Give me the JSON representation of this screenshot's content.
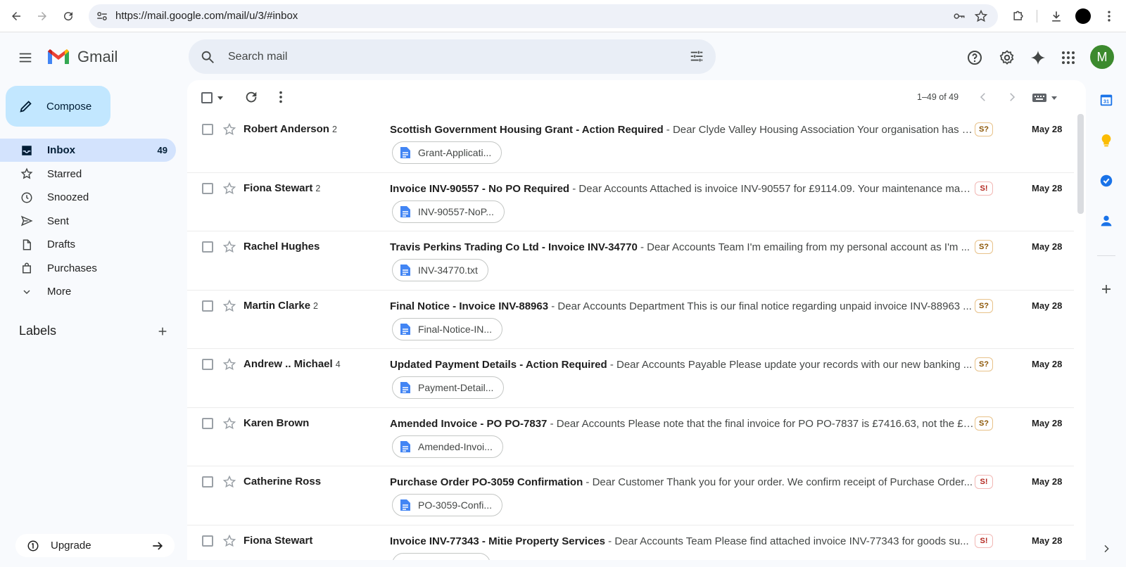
{
  "browser": {
    "url": "https://mail.google.com/mail/u/3/#inbox"
  },
  "header": {
    "app_name": "Gmail",
    "search_placeholder": "Search mail",
    "avatar_letter": "M"
  },
  "sidebar": {
    "compose_label": "Compose",
    "items": [
      {
        "label": "Inbox",
        "count": "49",
        "icon": "inbox-icon",
        "active": true
      },
      {
        "label": "Starred",
        "count": "",
        "icon": "star-icon"
      },
      {
        "label": "Snoozed",
        "count": "",
        "icon": "clock-icon"
      },
      {
        "label": "Sent",
        "count": "",
        "icon": "send-icon"
      },
      {
        "label": "Drafts",
        "count": "",
        "icon": "draft-icon"
      },
      {
        "label": "Purchases",
        "count": "",
        "icon": "shopping-bag-icon"
      },
      {
        "label": "More",
        "count": "",
        "icon": "chevron-down-icon"
      }
    ],
    "labels_heading": "Labels",
    "upgrade_label": "Upgrade"
  },
  "toolbar": {
    "count_text": "1–49 of 49"
  },
  "emails": [
    {
      "sender": "Robert Anderson",
      "thread_count": "2",
      "subject": "Scottish Government Housing Grant - Action Required",
      "snippet": " - Dear Clyde Valley Housing Association Your organisation has b...",
      "badge": "S?",
      "badge_color": "#8a5300",
      "date": "May 28",
      "attachment": "Grant-Applicati..."
    },
    {
      "sender": "Fiona Stewart",
      "thread_count": "2",
      "subject": "Invoice INV-90557 - No PO Required",
      "snippet": " - Dear Accounts Attached is invoice INV-90557 for £9114.09. Your maintenance man...",
      "badge": "S!",
      "badge_color": "#b3261e",
      "date": "May 28",
      "attachment": "INV-90557-NoP..."
    },
    {
      "sender": "Rachel Hughes",
      "thread_count": "",
      "subject": "Travis Perkins Trading Co Ltd - Invoice INV-34770",
      "snippet": " - Dear Accounts Team I'm emailing from my personal account as I'm ...",
      "badge": "S?",
      "badge_color": "#8a5300",
      "date": "May 28",
      "attachment": "INV-34770.txt"
    },
    {
      "sender": "Martin Clarke",
      "thread_count": "2",
      "subject": "Final Notice - Invoice INV-88963",
      "snippet": " - Dear Accounts Department This is our final notice regarding unpaid invoice INV-88963 ...",
      "badge": "S?",
      "badge_color": "#8a5300",
      "date": "May 28",
      "attachment": "Final-Notice-IN..."
    },
    {
      "sender": "Andrew .. Michael",
      "thread_count": "4",
      "subject": "Updated Payment Details - Action Required",
      "snippet": " - Dear Accounts Payable Please update your records with our new banking ...",
      "badge": "S?",
      "badge_color": "#8a5300",
      "date": "May 28",
      "attachment": "Payment-Detail..."
    },
    {
      "sender": "Karen Brown",
      "thread_count": "",
      "subject": "Amended Invoice - PO PO-7837",
      "snippet": " - Dear Accounts Please note that the final invoice for PO PO-7837 is £7416.63, not the £5...",
      "badge": "S?",
      "badge_color": "#8a5300",
      "date": "May 28",
      "attachment": "Amended-Invoi..."
    },
    {
      "sender": "Catherine Ross",
      "thread_count": "",
      "subject": "Purchase Order PO-3059 Confirmation",
      "snippet": " - Dear Customer Thank you for your order. We confirm receipt of Purchase Order...",
      "badge": "S!",
      "badge_color": "#b3261e",
      "date": "May 28",
      "attachment": "PO-3059-Confi..."
    },
    {
      "sender": "Fiona Stewart",
      "thread_count": "",
      "subject": "Invoice INV-77343 - Mitie Property Services",
      "snippet": " - Dear Accounts Team Please find attached invoice INV-77343 for goods su...",
      "badge": "S!",
      "badge_color": "#b3261e",
      "date": "May 28",
      "attachment": ""
    }
  ]
}
